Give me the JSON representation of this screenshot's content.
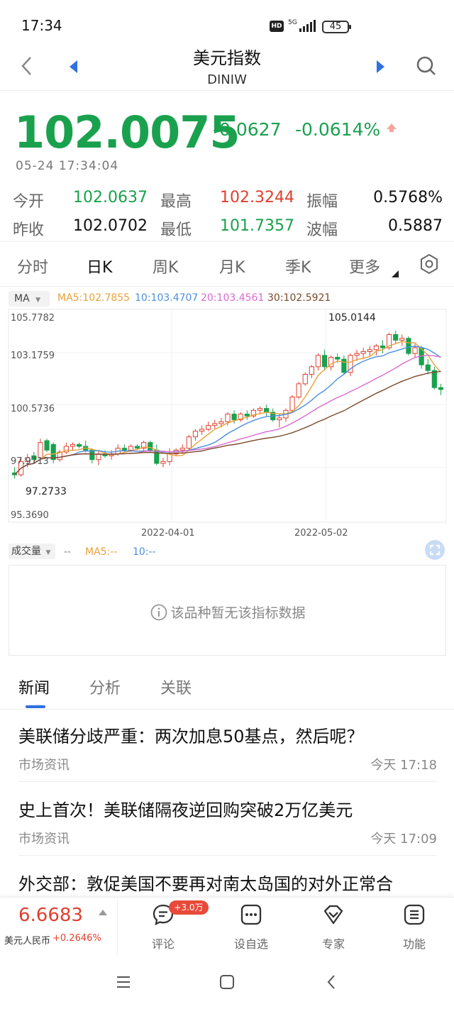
{
  "status_bar": {
    "time": "17:34",
    "network": "5G",
    "hd": "HD",
    "battery": "45"
  },
  "nav": {
    "title": "美元指数",
    "subtitle": "DINIW"
  },
  "quote": {
    "price": "102.0075",
    "change": "-0.0627",
    "change_pct": "-0.0614%",
    "timestamp": "05-24 17:34:04"
  },
  "stats": {
    "open_label": "今开",
    "open": "102.0637",
    "high_label": "最高",
    "high": "102.3244",
    "amplitude_label": "振幅",
    "amplitude": "0.5768%",
    "prev_close_label": "昨收",
    "prev_close": "102.0702",
    "low_label": "最低",
    "low": "101.7357",
    "wave_label": "波幅",
    "wave": "0.5887"
  },
  "period_tabs": [
    "分时",
    "日K",
    "周K",
    "月K",
    "季K",
    "更多"
  ],
  "active_period": "日K",
  "ma_legend": {
    "select": "MA",
    "ma5": "MA5:102.7855",
    "ma10": "10:103.4707",
    "ma20": "20:103.4561",
    "ma30": "30:102.5921"
  },
  "colors": {
    "up": "#e0402f",
    "down": "#1aa14e",
    "ma5": "#e6a23c",
    "ma10": "#4a8fe0",
    "ma20": "#d96ad0",
    "ma30": "#7a4a2a",
    "accent": "#2f6fe0"
  },
  "chart_data": {
    "type": "candlestick",
    "y_ticks": [
      "105.7782",
      "103.1759",
      "100.5736",
      "97.9713",
      "95.3690"
    ],
    "x_ticks": [
      "2022-04-01",
      "2022-05-02"
    ],
    "annotations": {
      "max": "105.0144",
      "min": "97.2733"
    },
    "ylim": [
      95.369,
      105.7782
    ],
    "candles": [
      [
        97.6,
        97.9,
        97.3,
        97.5
      ],
      [
        97.5,
        98.4,
        97.4,
        98.2
      ],
      [
        98.2,
        98.6,
        97.9,
        98.4
      ],
      [
        98.5,
        98.7,
        98.2,
        98.3
      ],
      [
        98.4,
        99.4,
        98.3,
        99.2
      ],
      [
        99.3,
        99.4,
        98.7,
        98.8
      ],
      [
        99.1,
        99.2,
        98.1,
        98.3
      ],
      [
        98.3,
        98.8,
        98.2,
        98.7
      ],
      [
        98.7,
        99.2,
        98.6,
        99.0
      ],
      [
        99.0,
        99.2,
        98.8,
        99.1
      ],
      [
        99.1,
        99.2,
        98.9,
        99.0
      ],
      [
        99.0,
        99.3,
        98.7,
        98.8
      ],
      [
        98.8,
        98.9,
        98.1,
        98.3
      ],
      [
        98.3,
        98.8,
        98.0,
        98.6
      ],
      [
        98.6,
        98.8,
        98.4,
        98.5
      ],
      [
        98.5,
        98.8,
        98.3,
        98.6
      ],
      [
        98.6,
        99.1,
        98.5,
        98.9
      ],
      [
        98.9,
        99.1,
        98.7,
        98.8
      ],
      [
        98.8,
        99.1,
        98.7,
        99.0
      ],
      [
        99.0,
        99.1,
        98.8,
        98.9
      ],
      [
        98.9,
        99.3,
        98.7,
        99.2
      ],
      [
        99.2,
        99.3,
        98.7,
        98.8
      ],
      [
        98.8,
        99.1,
        98.0,
        98.1
      ],
      [
        98.1,
        98.4,
        97.9,
        98.2
      ],
      [
        98.2,
        98.9,
        98.0,
        98.6
      ],
      [
        98.6,
        98.9,
        98.5,
        98.8
      ],
      [
        98.8,
        99.1,
        98.6,
        98.9
      ],
      [
        98.9,
        99.6,
        98.8,
        99.5
      ],
      [
        99.5,
        99.9,
        99.3,
        99.8
      ],
      [
        99.8,
        100.1,
        99.6,
        99.9
      ],
      [
        99.9,
        100.3,
        99.8,
        100.1
      ],
      [
        100.1,
        100.4,
        99.9,
        100.2
      ],
      [
        100.2,
        100.5,
        100.0,
        100.3
      ],
      [
        100.3,
        100.8,
        100.1,
        100.7
      ],
      [
        100.7,
        100.9,
        100.2,
        100.4
      ],
      [
        100.4,
        100.8,
        100.3,
        100.7
      ],
      [
        100.7,
        100.9,
        100.4,
        100.6
      ],
      [
        100.6,
        101.0,
        100.5,
        100.9
      ],
      [
        100.9,
        101.1,
        100.7,
        101.0
      ],
      [
        101.0,
        101.2,
        100.6,
        100.8
      ],
      [
        100.8,
        101.0,
        100.3,
        100.4
      ],
      [
        100.4,
        100.7,
        100.0,
        100.5
      ],
      [
        100.5,
        101.0,
        100.3,
        100.9
      ],
      [
        100.9,
        101.7,
        100.8,
        101.6
      ],
      [
        101.6,
        102.4,
        101.5,
        102.3
      ],
      [
        102.3,
        102.9,
        102.2,
        102.8
      ],
      [
        102.8,
        103.3,
        102.6,
        103.2
      ],
      [
        103.2,
        103.9,
        103.0,
        103.8
      ],
      [
        103.8,
        104.1,
        103.0,
        103.2
      ],
      [
        103.2,
        103.8,
        103.0,
        103.7
      ],
      [
        103.7,
        103.9,
        103.4,
        103.6
      ],
      [
        103.6,
        103.8,
        102.8,
        102.9
      ],
      [
        102.9,
        103.9,
        102.7,
        103.8
      ],
      [
        103.8,
        104.1,
        103.5,
        103.9
      ],
      [
        103.9,
        104.2,
        103.6,
        104.0
      ],
      [
        104.0,
        104.3,
        103.7,
        104.1
      ],
      [
        104.1,
        104.4,
        103.8,
        104.3
      ],
      [
        104.3,
        104.6,
        103.9,
        104.2
      ],
      [
        104.2,
        105.0,
        104.1,
        104.9
      ],
      [
        104.9,
        105.1,
        104.4,
        104.6
      ],
      [
        104.6,
        104.9,
        104.3,
        104.7
      ],
      [
        104.7,
        104.8,
        103.8,
        103.9
      ],
      [
        103.9,
        104.4,
        103.7,
        104.2
      ],
      [
        104.2,
        104.3,
        103.1,
        103.3
      ],
      [
        103.3,
        103.6,
        102.8,
        103.0
      ],
      [
        103.0,
        103.2,
        102.0,
        102.1
      ],
      [
        102.1,
        102.3,
        101.7,
        102.0
      ]
    ]
  },
  "volume": {
    "select": "成交量",
    "legend_dash": "--",
    "ma5": "MA5:--",
    "ma10": "10:--",
    "no_data": "该品种暂无该指标数据"
  },
  "news_tabs": [
    "新闻",
    "分析",
    "关联"
  ],
  "news": [
    {
      "title": "美联储分歧严重：两次加息50基点，然后呢？",
      "source": "市场资讯",
      "time": "今天 17:18"
    },
    {
      "title": "史上首次！美联储隔夜逆回购突破2万亿美元",
      "source": "市场资讯",
      "time": "今天 17:09"
    },
    {
      "title": "外交部：敦促美国不要再对南太岛国的对外正常合",
      "source": "",
      "time": ""
    }
  ],
  "bottom_bar": {
    "related_price": "6.6683",
    "related_name": "美元人民币",
    "related_pct": "+0.2646%",
    "comment_label": "评论",
    "comment_badge": "+3.0万",
    "watchlist_label": "设自选",
    "expert_label": "专家",
    "function_label": "功能"
  }
}
